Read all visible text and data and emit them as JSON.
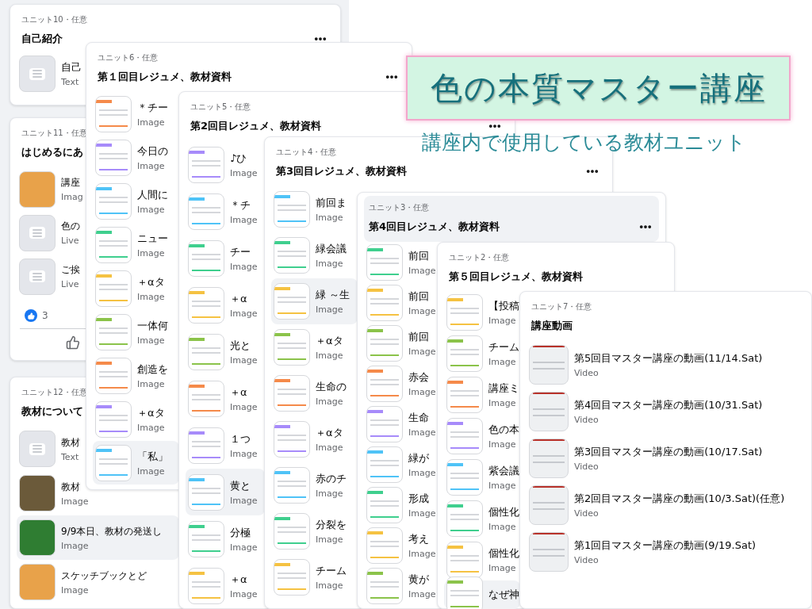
{
  "banner": {
    "title": "色の本質マスター講座",
    "subtitle": "講座内で使用している教材ユニット"
  },
  "units": [
    {
      "label": "ユニット10・任意",
      "title": "自己紹介",
      "has_menu": true,
      "header_highlighted": false,
      "items": [
        {
          "title": "自己",
          "subtitle": "Text",
          "kind": "text",
          "selected": false
        }
      ]
    },
    {
      "label": "ユニット11・任意",
      "title": "はじめるにあ",
      "has_menu": false,
      "header_highlighted": false,
      "items": [
        {
          "title": "講座",
          "subtitle": "Imag",
          "kind": "photo",
          "selected": false
        },
        {
          "title": "色の",
          "subtitle": "Live",
          "kind": "text",
          "selected": false
        },
        {
          "title": "ご挨",
          "subtitle": "Live",
          "kind": "text",
          "selected": false
        }
      ],
      "reactions": {
        "count": "3"
      }
    },
    {
      "label": "ユニット12・任意",
      "title": "教材について",
      "has_menu": false,
      "header_highlighted": false,
      "items": [
        {
          "title": "教材",
          "subtitle": "Text",
          "kind": "text",
          "selected": false
        },
        {
          "title": "教材",
          "subtitle": "Image",
          "kind": "photo",
          "selected": false
        },
        {
          "title": "9/9本日、教材の発送し",
          "subtitle": "Image",
          "kind": "photo",
          "selected": true
        },
        {
          "title": "スケッチブックとど",
          "subtitle": "Image",
          "kind": "photo",
          "selected": false
        }
      ]
    },
    {
      "label": "ユニット6・任意",
      "title": "第１回目レジュメ、教材資料",
      "has_menu": true,
      "header_highlighted": false,
      "items": [
        {
          "title": "＊チー",
          "subtitle": "Image",
          "kind": "slide",
          "selected": false
        },
        {
          "title": "今日の",
          "subtitle": "Image",
          "kind": "slide",
          "selected": false
        },
        {
          "title": "人間に",
          "subtitle": "Image",
          "kind": "slide",
          "selected": false
        },
        {
          "title": "ニュー",
          "subtitle": "Image",
          "kind": "slide",
          "selected": false
        },
        {
          "title": "＋αタ",
          "subtitle": "Image",
          "kind": "slide",
          "selected": false
        },
        {
          "title": "一体何",
          "subtitle": "Image",
          "kind": "slide",
          "selected": false
        },
        {
          "title": "創造を",
          "subtitle": "Image",
          "kind": "slide",
          "selected": false
        },
        {
          "title": "＋αタ",
          "subtitle": "Image",
          "kind": "slide",
          "selected": false
        },
        {
          "title": "「私」",
          "subtitle": "Image",
          "kind": "slide",
          "selected": true
        }
      ]
    },
    {
      "label": "ユニット5・任意",
      "title": "第2回目レジュメ、教材資料",
      "has_menu": true,
      "header_highlighted": false,
      "items": [
        {
          "title": "♪ひ",
          "subtitle": "Image",
          "kind": "slide",
          "selected": false
        },
        {
          "title": "＊チ",
          "subtitle": "Image",
          "kind": "slide",
          "selected": false
        },
        {
          "title": "チー",
          "subtitle": "Image",
          "kind": "slide",
          "selected": false
        },
        {
          "title": "＋α",
          "subtitle": "Image",
          "kind": "slide",
          "selected": false
        },
        {
          "title": "光と",
          "subtitle": "Image",
          "kind": "slide",
          "selected": false
        },
        {
          "title": "＋α",
          "subtitle": "Image",
          "kind": "slide",
          "selected": false
        },
        {
          "title": "１つ",
          "subtitle": "Image",
          "kind": "slide",
          "selected": false
        },
        {
          "title": "黄と",
          "subtitle": "Image",
          "kind": "slide",
          "selected": true
        },
        {
          "title": "分極",
          "subtitle": "Image",
          "kind": "slide",
          "selected": false
        },
        {
          "title": "＋α",
          "subtitle": "Image",
          "kind": "slide",
          "selected": false
        }
      ]
    },
    {
      "label": "ユニット4・任意",
      "title": "第3回目レジュメ、教材資料",
      "has_menu": true,
      "header_highlighted": false,
      "items": [
        {
          "title": "前回ま",
          "subtitle": "Image",
          "kind": "slide",
          "selected": false
        },
        {
          "title": "緑会議",
          "subtitle": "Image",
          "kind": "slide",
          "selected": false
        },
        {
          "title": "緑 ～生",
          "subtitle": "Image",
          "kind": "slide",
          "selected": true
        },
        {
          "title": "＋αタ",
          "subtitle": "Image",
          "kind": "slide",
          "selected": false
        },
        {
          "title": "生命の",
          "subtitle": "Image",
          "kind": "slide",
          "selected": false
        },
        {
          "title": "＋αタ",
          "subtitle": "Image",
          "kind": "slide",
          "selected": false
        },
        {
          "title": "赤のチ",
          "subtitle": "Image",
          "kind": "slide",
          "selected": false
        },
        {
          "title": "分裂を",
          "subtitle": "Image",
          "kind": "slide",
          "selected": false
        },
        {
          "title": "チーム",
          "subtitle": "Image",
          "kind": "slide",
          "selected": false
        }
      ]
    },
    {
      "label": "ユニット3・任意",
      "title": "第4回目レジュメ、教材資料",
      "has_menu": true,
      "header_highlighted": true,
      "items": [
        {
          "title": "前回",
          "subtitle": "Image",
          "kind": "slide",
          "selected": false
        },
        {
          "title": "前回",
          "subtitle": "Image",
          "kind": "slide",
          "selected": false
        },
        {
          "title": "前回",
          "subtitle": "Image",
          "kind": "slide",
          "selected": false
        },
        {
          "title": "赤会",
          "subtitle": "Image",
          "kind": "slide",
          "selected": false
        },
        {
          "title": "生命",
          "subtitle": "Image",
          "kind": "slide",
          "selected": false
        },
        {
          "title": "緑が",
          "subtitle": "Image",
          "kind": "slide",
          "selected": false
        },
        {
          "title": "形成",
          "subtitle": "Image",
          "kind": "slide",
          "selected": false
        },
        {
          "title": "考え",
          "subtitle": "Image",
          "kind": "slide",
          "selected": false
        },
        {
          "title": "黄が",
          "subtitle": "Image",
          "kind": "slide",
          "selected": false
        }
      ]
    },
    {
      "label": "ユニット2・任意",
      "title": "第５回目レジュメ、教材資料",
      "has_menu": false,
      "header_highlighted": false,
      "items": [
        {
          "title": "【投稿",
          "subtitle": "Image",
          "kind": "slide",
          "selected": false
        },
        {
          "title": "チーム",
          "subtitle": "Image",
          "kind": "slide",
          "selected": false
        },
        {
          "title": "講座ミ",
          "subtitle": "Image",
          "kind": "slide",
          "selected": false
        },
        {
          "title": "色の本",
          "subtitle": "Image",
          "kind": "slide",
          "selected": false
        },
        {
          "title": "紫会議",
          "subtitle": "Image",
          "kind": "slide",
          "selected": false
        },
        {
          "title": "個性化",
          "subtitle": "Image",
          "kind": "slide",
          "selected": false
        },
        {
          "title": "個性化",
          "subtitle": "Image",
          "kind": "slide",
          "selected": false
        },
        {
          "title": "なぜ神",
          "kind": "slide",
          "selected": true
        }
      ]
    },
    {
      "label": "ユニット7・任意",
      "title": "講座動画",
      "has_menu": false,
      "header_highlighted": false,
      "items": [
        {
          "title": "第5回目マスター講座の動画(11/14.Sat)",
          "subtitle": "Video",
          "kind": "video",
          "selected": false
        },
        {
          "title": "第4回目マスター講座の動画(10/31.Sat)",
          "subtitle": "Video",
          "kind": "video",
          "selected": false
        },
        {
          "title": "第3回目マスター講座の動画(10/17.Sat)",
          "subtitle": "Video",
          "kind": "video",
          "selected": false
        },
        {
          "title": "第2回目マスター講座の動画(10/3.Sat)(任意)",
          "subtitle": "Video",
          "kind": "video",
          "selected": false
        },
        {
          "title": "第1回目マスター講座の動画(9/19.Sat)",
          "subtitle": "Video",
          "kind": "video",
          "selected": false
        }
      ]
    }
  ]
}
